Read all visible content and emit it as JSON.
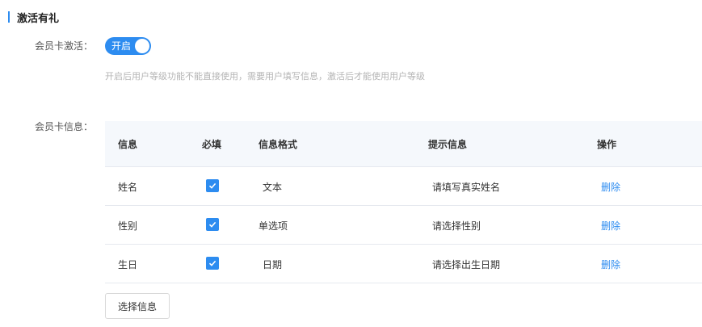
{
  "section": {
    "title": "激活有礼"
  },
  "activation": {
    "label": "会员卡激活：",
    "switch_text": "开启",
    "enabled": true,
    "hint": "开启后用户等级功能不能直接使用，需要用户填写信息，激活后才能使用用户等级"
  },
  "info": {
    "label": "会员卡信息：",
    "columns": [
      "信息",
      "必填",
      "信息格式",
      "提示信息",
      "操作"
    ],
    "rows": [
      {
        "name": "姓名",
        "required": true,
        "format": "文本",
        "tip": "请填写真实姓名",
        "action": "删除"
      },
      {
        "name": "性别",
        "required": true,
        "format": "单选项",
        "tip": "请选择性别",
        "action": "删除"
      },
      {
        "name": "生日",
        "required": true,
        "format": "日期",
        "tip": "请选择出生日期",
        "action": "删除"
      }
    ]
  },
  "select_button": {
    "label": "选择信息"
  },
  "colors": {
    "accent": "#2d8cf0",
    "header_bg": "#f5f8fc",
    "hint": "#b4b4b4"
  }
}
